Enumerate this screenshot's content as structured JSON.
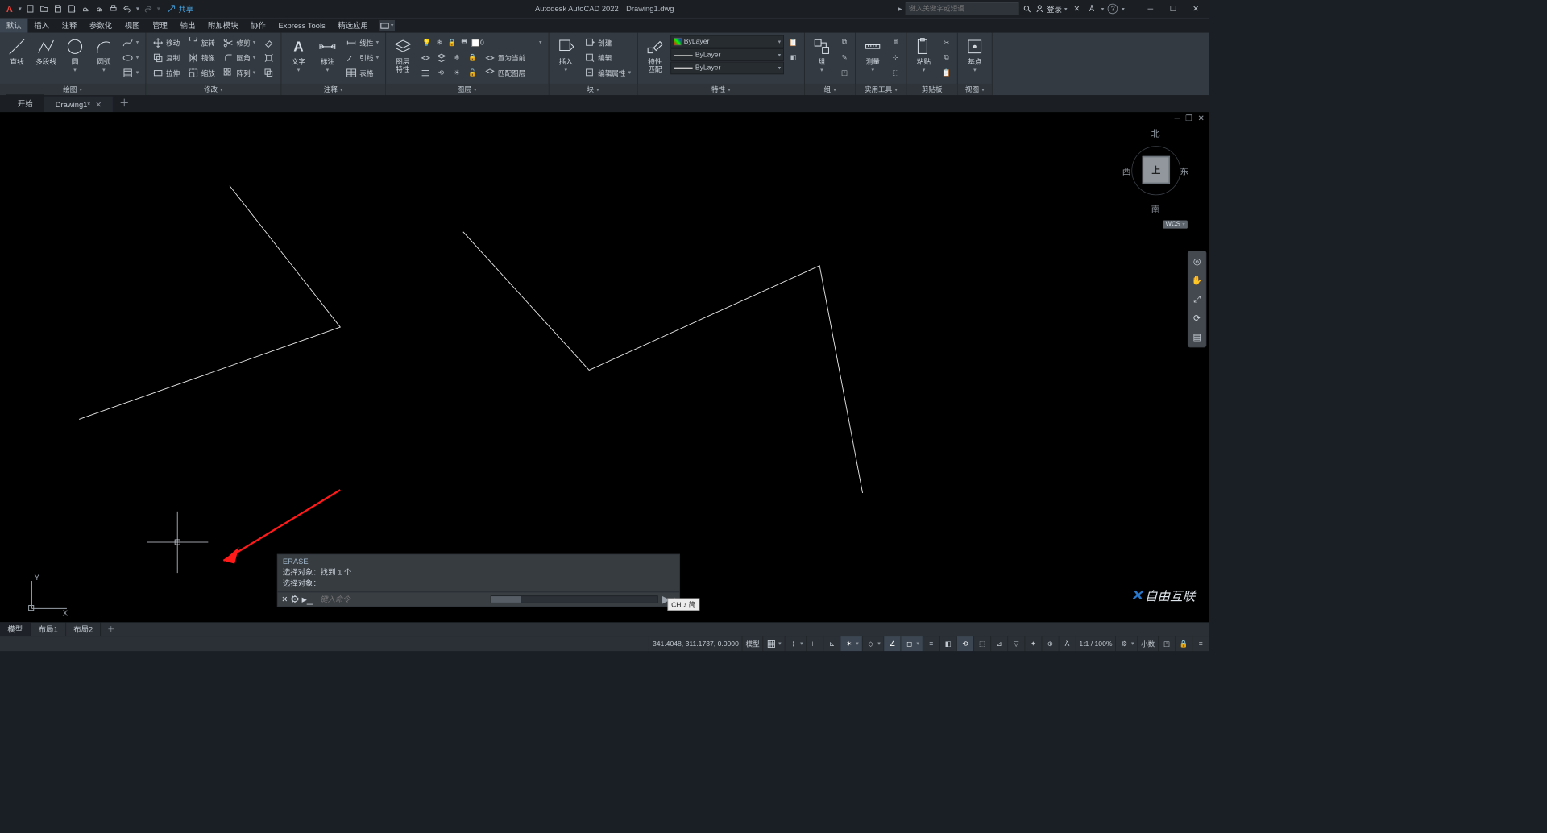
{
  "app": {
    "name": "Autodesk AutoCAD 2022",
    "file": "Drawing1.dwg"
  },
  "share_label": "共享",
  "search_placeholder": "键入关键字或短语",
  "login_label": "登录",
  "menu_tabs": [
    "默认",
    "插入",
    "注释",
    "参数化",
    "视图",
    "管理",
    "输出",
    "附加模块",
    "协作",
    "Express Tools",
    "精选应用"
  ],
  "ribbon": {
    "draw": {
      "title": "绘图",
      "line": "直线",
      "polyline": "多段线",
      "circle": "圆",
      "arc": "圆弧"
    },
    "modify": {
      "title": "修改",
      "move": "移动",
      "rotate": "旋转",
      "trim": "修剪",
      "copy": "复制",
      "mirror": "镜像",
      "fillet": "圆角",
      "stretch": "拉伸",
      "scale": "缩放",
      "array": "阵列"
    },
    "annot": {
      "title": "注释",
      "text": "文字",
      "dim": "标注",
      "table": "表格",
      "linear": "线性",
      "leader": "引线"
    },
    "layer": {
      "title": "图层",
      "propmgr": "图层\n特性",
      "setcurrent": "置为当前",
      "matchlayer": "匹配图层",
      "dropdown": "0"
    },
    "block": {
      "title": "块",
      "insert": "插入",
      "create": "创建",
      "edit": "编辑",
      "editattr": "编辑属性"
    },
    "props": {
      "title": "特性",
      "match": "特性\n匹配",
      "layer": "ByLayer",
      "ltype": "ByLayer",
      "lwt": "ByLayer"
    },
    "group": {
      "title": "组",
      "btn": "组"
    },
    "util": {
      "title": "实用工具",
      "measure": "测量"
    },
    "clip": {
      "title": "剪贴板",
      "paste": "粘贴"
    },
    "view": {
      "title": "视图",
      "base": "基点"
    }
  },
  "doc_tabs": {
    "start": "开始",
    "drawing": "Drawing1*"
  },
  "viewcube": {
    "n": "北",
    "s": "南",
    "e": "东",
    "w": "西",
    "top": "上",
    "wcs": "WCS"
  },
  "cmd": {
    "erase": "ERASE",
    "line1": "选择对象：找到 1 个",
    "line2": "选择对象：",
    "placeholder": "键入命令"
  },
  "ime": "CH ♪ 简",
  "layout_tabs": [
    "模型",
    "布局1",
    "布局2"
  ],
  "status": {
    "coords": "341.4048, 311.1737, 0.0000",
    "model": "模型",
    "scale": "1:1 / 100%",
    "decimal": "小数"
  },
  "watermark": "自由互联"
}
